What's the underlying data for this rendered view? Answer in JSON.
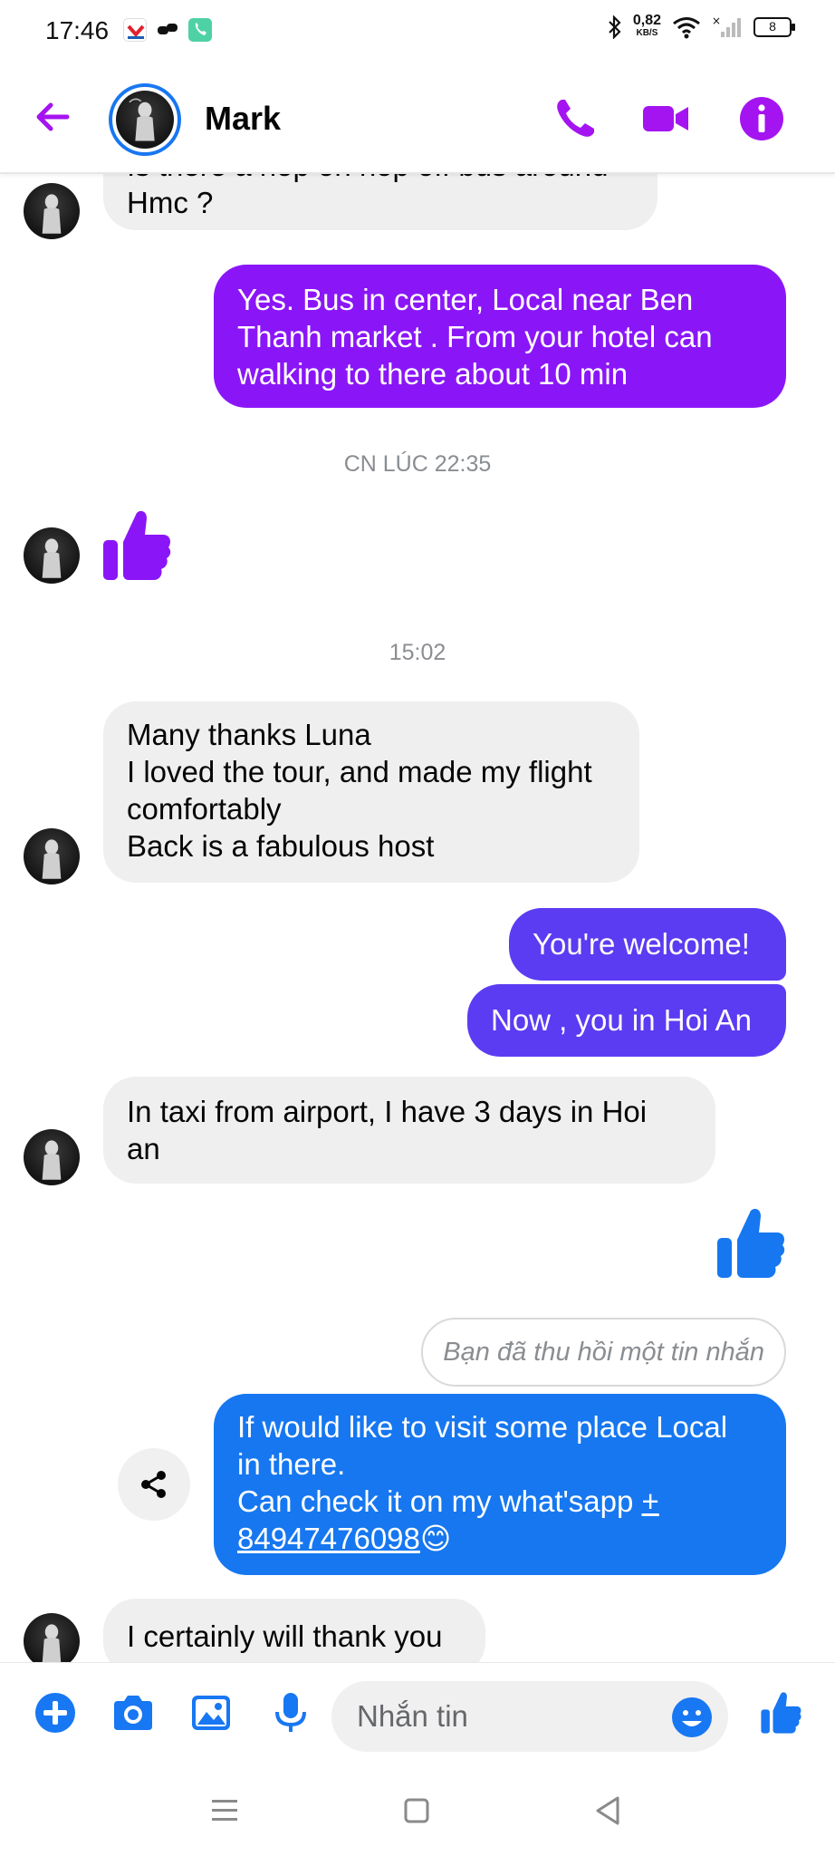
{
  "status_bar": {
    "time": "17:46",
    "net_speed_value": "0,82",
    "net_speed_unit": "KB/S",
    "battery": "8"
  },
  "header": {
    "contact_name": "Mark"
  },
  "messages": {
    "m1": "Is there a hop on hop off bus around\nHmc ?",
    "m2": "Yes. Bus in center, Local near Ben\nThanh market . From your hotel can\nwalking to there about 10 min",
    "ts1": "CN LÚC 22:35",
    "ts2": "15:02",
    "m3": "Many thanks Luna\nI loved the tour, and made my flight\ncomfortably\nBack is a fabulous host",
    "m4": "You're welcome!",
    "m5": "Now , you in Hoi An",
    "m6": "In taxi from airport, I have 3 days in Hoi\nan",
    "unsent": "Bạn đã thu hồi một tin nhắn",
    "m7_text": "If would like to visit some place Local\nin there.\nCan check it on my what'sapp ",
    "m7_phone": "+\n84947476098",
    "m7_emoji": "😊",
    "m8": "I certainly will thank you"
  },
  "composer": {
    "placeholder": "Nhắn tin"
  },
  "colors": {
    "accent_purple": "#8a16f8",
    "accent_indigo": "#5b3cf2",
    "accent_blue": "#1677f0",
    "received_bg": "#efefef",
    "icon_blue": "#1877f2",
    "header_icon_purple": "#a414f0"
  },
  "icons": {
    "back": "arrow-left-icon",
    "call": "phone-icon",
    "video": "video-camera-icon",
    "info": "info-icon",
    "like": "thumbs-up-icon",
    "share": "share-icon",
    "plus": "plus-icon",
    "camera": "camera-icon",
    "gallery": "image-icon",
    "mic": "microphone-icon",
    "emoji": "smiley-icon"
  }
}
